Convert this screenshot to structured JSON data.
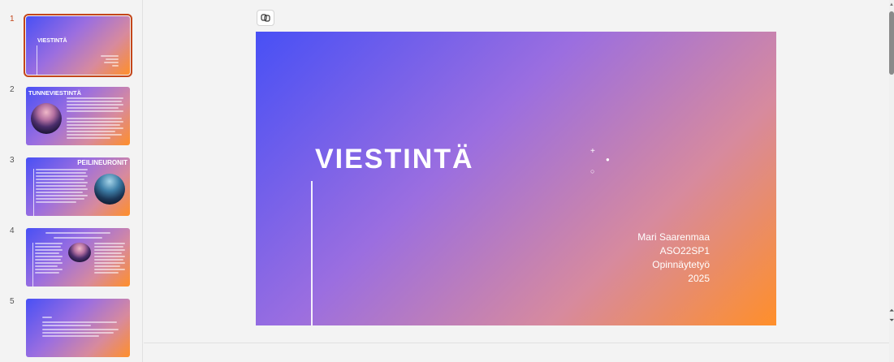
{
  "thumbnails": [
    {
      "number": "1",
      "title": "VIESTINTÄ",
      "active": true
    },
    {
      "number": "2",
      "title": "TUNNEVIESTINTÄ",
      "active": false
    },
    {
      "number": "3",
      "title": "PEILINEURONIT",
      "active": false
    },
    {
      "number": "4",
      "title": "",
      "active": false
    },
    {
      "number": "5",
      "title": "",
      "active": false
    }
  ],
  "slide": {
    "title": "VIESTINTÄ",
    "subtitle_lines": [
      "Mari Saarenmaa",
      "ASO22SP1",
      "Opinnäytetyö",
      "2025"
    ]
  },
  "icons": {
    "copilot": "copilot-icon",
    "scroll_up": "chevron-up-icon",
    "scroll_prev": "double-chevron-up-icon",
    "scroll_next": "double-chevron-down-icon"
  },
  "colors": {
    "accent": "#c4461a",
    "gradient_start": "#4850f5",
    "gradient_mid": "#d78a9e",
    "gradient_end": "#ff8f2a"
  }
}
